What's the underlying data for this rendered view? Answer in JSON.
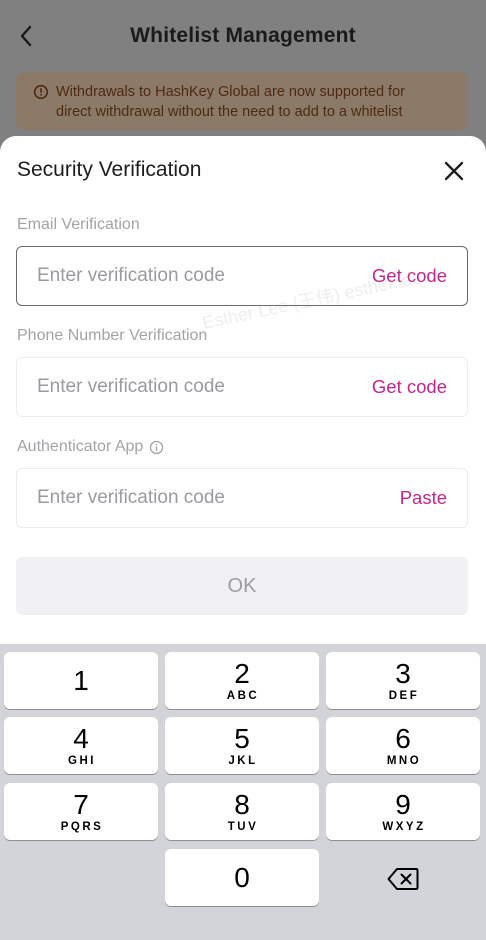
{
  "background_page": {
    "title": "Whitelist Management",
    "notice_line1": "Withdrawals to HashKey Global are now supported for",
    "notice_line2": "direct withdrawal without the need to add to a whitelist"
  },
  "sheet": {
    "title": "Security Verification",
    "email": {
      "label": "Email Verification",
      "placeholder": "Enter verification code",
      "value": "",
      "action": "Get code"
    },
    "phone": {
      "label": "Phone Number Verification",
      "placeholder": "Enter verification code",
      "value": "",
      "action": "Get code"
    },
    "authenticator": {
      "label": "Authenticator App",
      "placeholder": "Enter verification code",
      "value": "",
      "action": "Paste"
    },
    "ok_label": "OK"
  },
  "keyboard": {
    "keys": [
      {
        "num": "1",
        "letters": ""
      },
      {
        "num": "2",
        "letters": "ABC"
      },
      {
        "num": "3",
        "letters": "DEF"
      },
      {
        "num": "4",
        "letters": "GHI"
      },
      {
        "num": "5",
        "letters": "JKL"
      },
      {
        "num": "6",
        "letters": "MNO"
      },
      {
        "num": "7",
        "letters": "PQRS"
      },
      {
        "num": "8",
        "letters": "TUV"
      },
      {
        "num": "9",
        "letters": "WXYZ"
      },
      {
        "num": "0",
        "letters": ""
      }
    ]
  },
  "watermark_text": "Esther Lee (王伟)  esther.lee",
  "colors": {
    "accent": "#c2278a",
    "sheet_bg": "#ffffff",
    "keyboard_bg": "#d2d4d9",
    "notice_text": "#4d2a12"
  },
  "icons": {
    "back": "chevron-left-icon",
    "notice": "info-circle-icon",
    "close": "close-icon",
    "auth_info": "info-circle-icon",
    "delete": "backspace-icon"
  }
}
